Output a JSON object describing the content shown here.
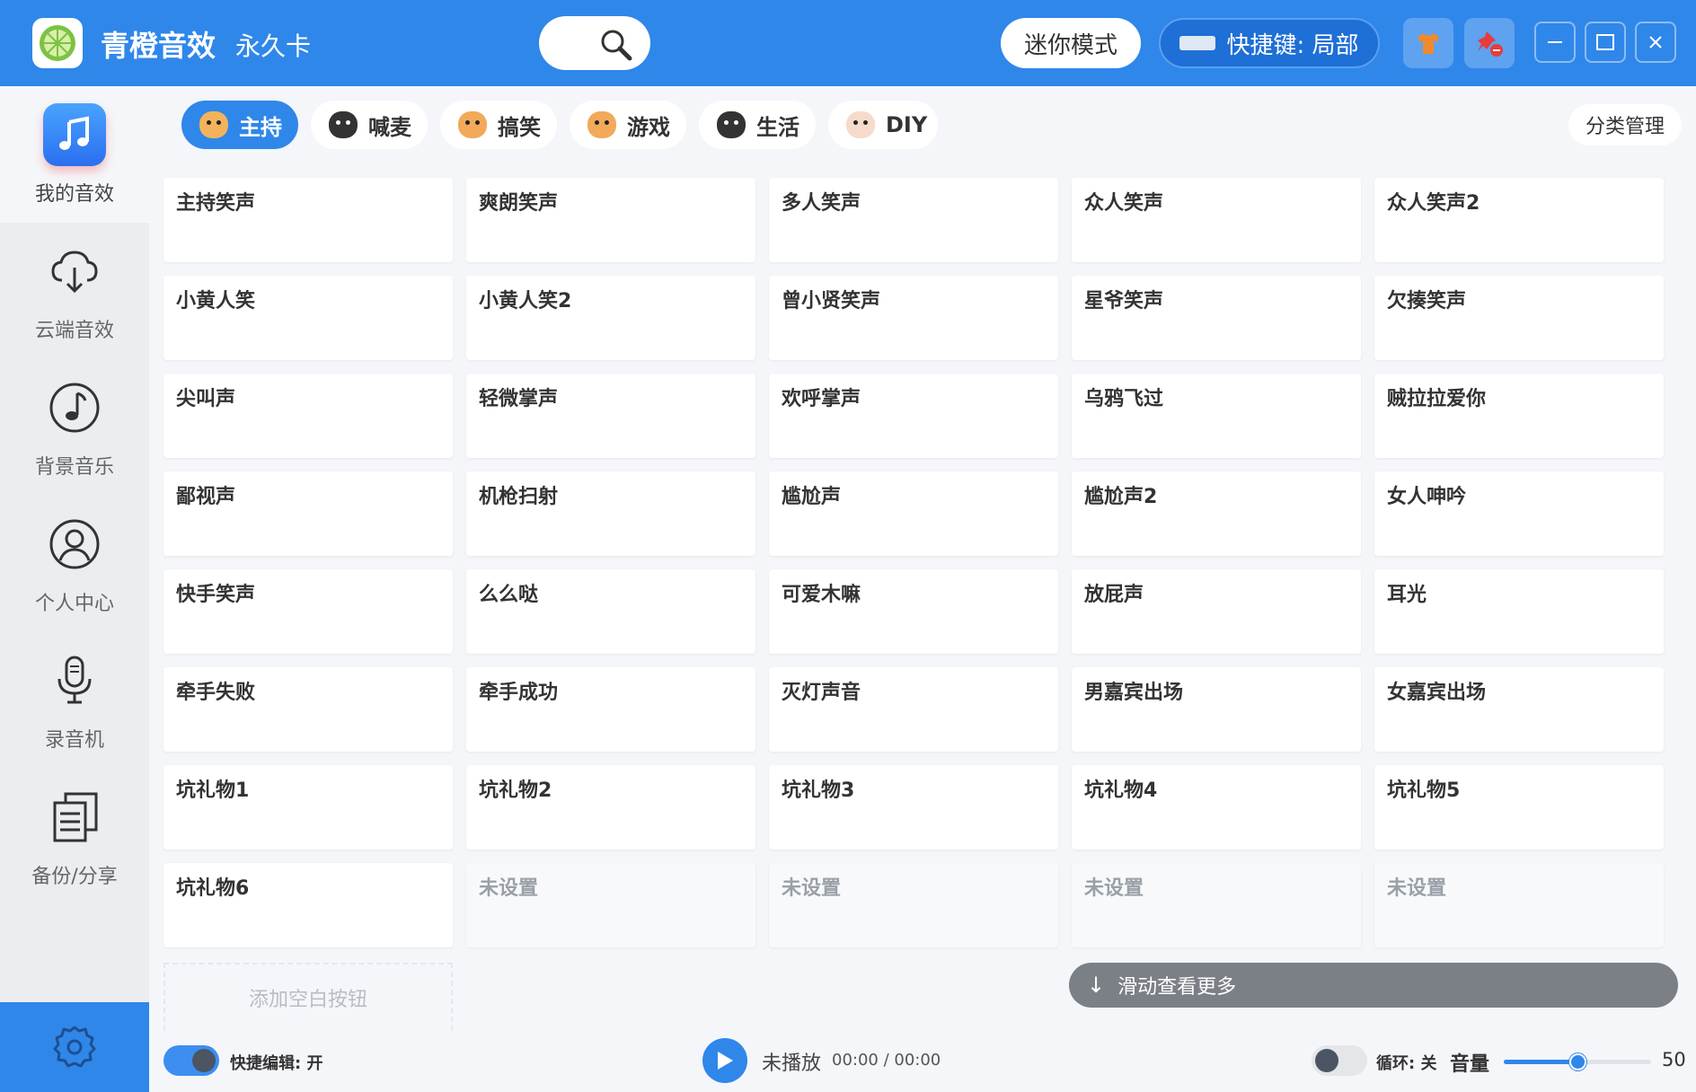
{
  "app": {
    "name": "青橙音效",
    "edition": "永久卡"
  },
  "header": {
    "mini_mode": "迷你模式",
    "hotkey": "快捷键: 局部"
  },
  "sidebar": {
    "items": [
      {
        "label": "我的音效",
        "icon": "music-note-icon"
      },
      {
        "label": "云端音效",
        "icon": "cloud-download-icon"
      },
      {
        "label": "背景音乐",
        "icon": "music-disc-icon"
      },
      {
        "label": "个人中心",
        "icon": "user-icon"
      },
      {
        "label": "录音机",
        "icon": "microphone-icon"
      },
      {
        "label": "备份/分享",
        "icon": "documents-icon"
      }
    ]
  },
  "tabs": [
    {
      "label": "主持",
      "icon": "dog-face-icon"
    },
    {
      "label": "喊麦",
      "icon": "husky-face-icon"
    },
    {
      "label": "搞笑",
      "icon": "shiba-face-icon"
    },
    {
      "label": "游戏",
      "icon": "shiba-face-icon"
    },
    {
      "label": "生活",
      "icon": "husky-face-icon"
    },
    {
      "label": "DIY",
      "icon": "cat-face-icon"
    }
  ],
  "category_manage": "分类管理",
  "sounds": [
    "主持笑声",
    "爽朗笑声",
    "多人笑声",
    "众人笑声",
    "众人笑声2",
    "小黄人笑",
    "小黄人笑2",
    "曾小贤笑声",
    "星爷笑声",
    "欠揍笑声",
    "尖叫声",
    "轻微掌声",
    "欢呼掌声",
    "乌鸦飞过",
    "贼拉拉爱你",
    "鄙视声",
    "机枪扫射",
    "尴尬声",
    "尴尬声2",
    "女人呻吟",
    "快手笑声",
    "么么哒",
    "可爱木嘛",
    "放屁声",
    "耳光",
    "牵手失败",
    "牵手成功",
    "灭灯声音",
    "男嘉宾出场",
    "女嘉宾出场",
    "坑礼物1",
    "坑礼物2",
    "坑礼物3",
    "坑礼物4",
    "坑礼物5",
    "坑礼物6",
    "未设置",
    "未设置",
    "未设置",
    "未设置"
  ],
  "add_blank": "添加空白按钮",
  "scroll_hint": "滑动查看更多",
  "bottom": {
    "quick_edit": "快捷编辑: 开",
    "status": "未播放",
    "time": "00:00 / 00:00",
    "loop": "循环: 关",
    "volume_label": "音量",
    "volume": "50",
    "volume_fraction": 0.5
  },
  "colors": {
    "accent": "#2f87ea"
  }
}
